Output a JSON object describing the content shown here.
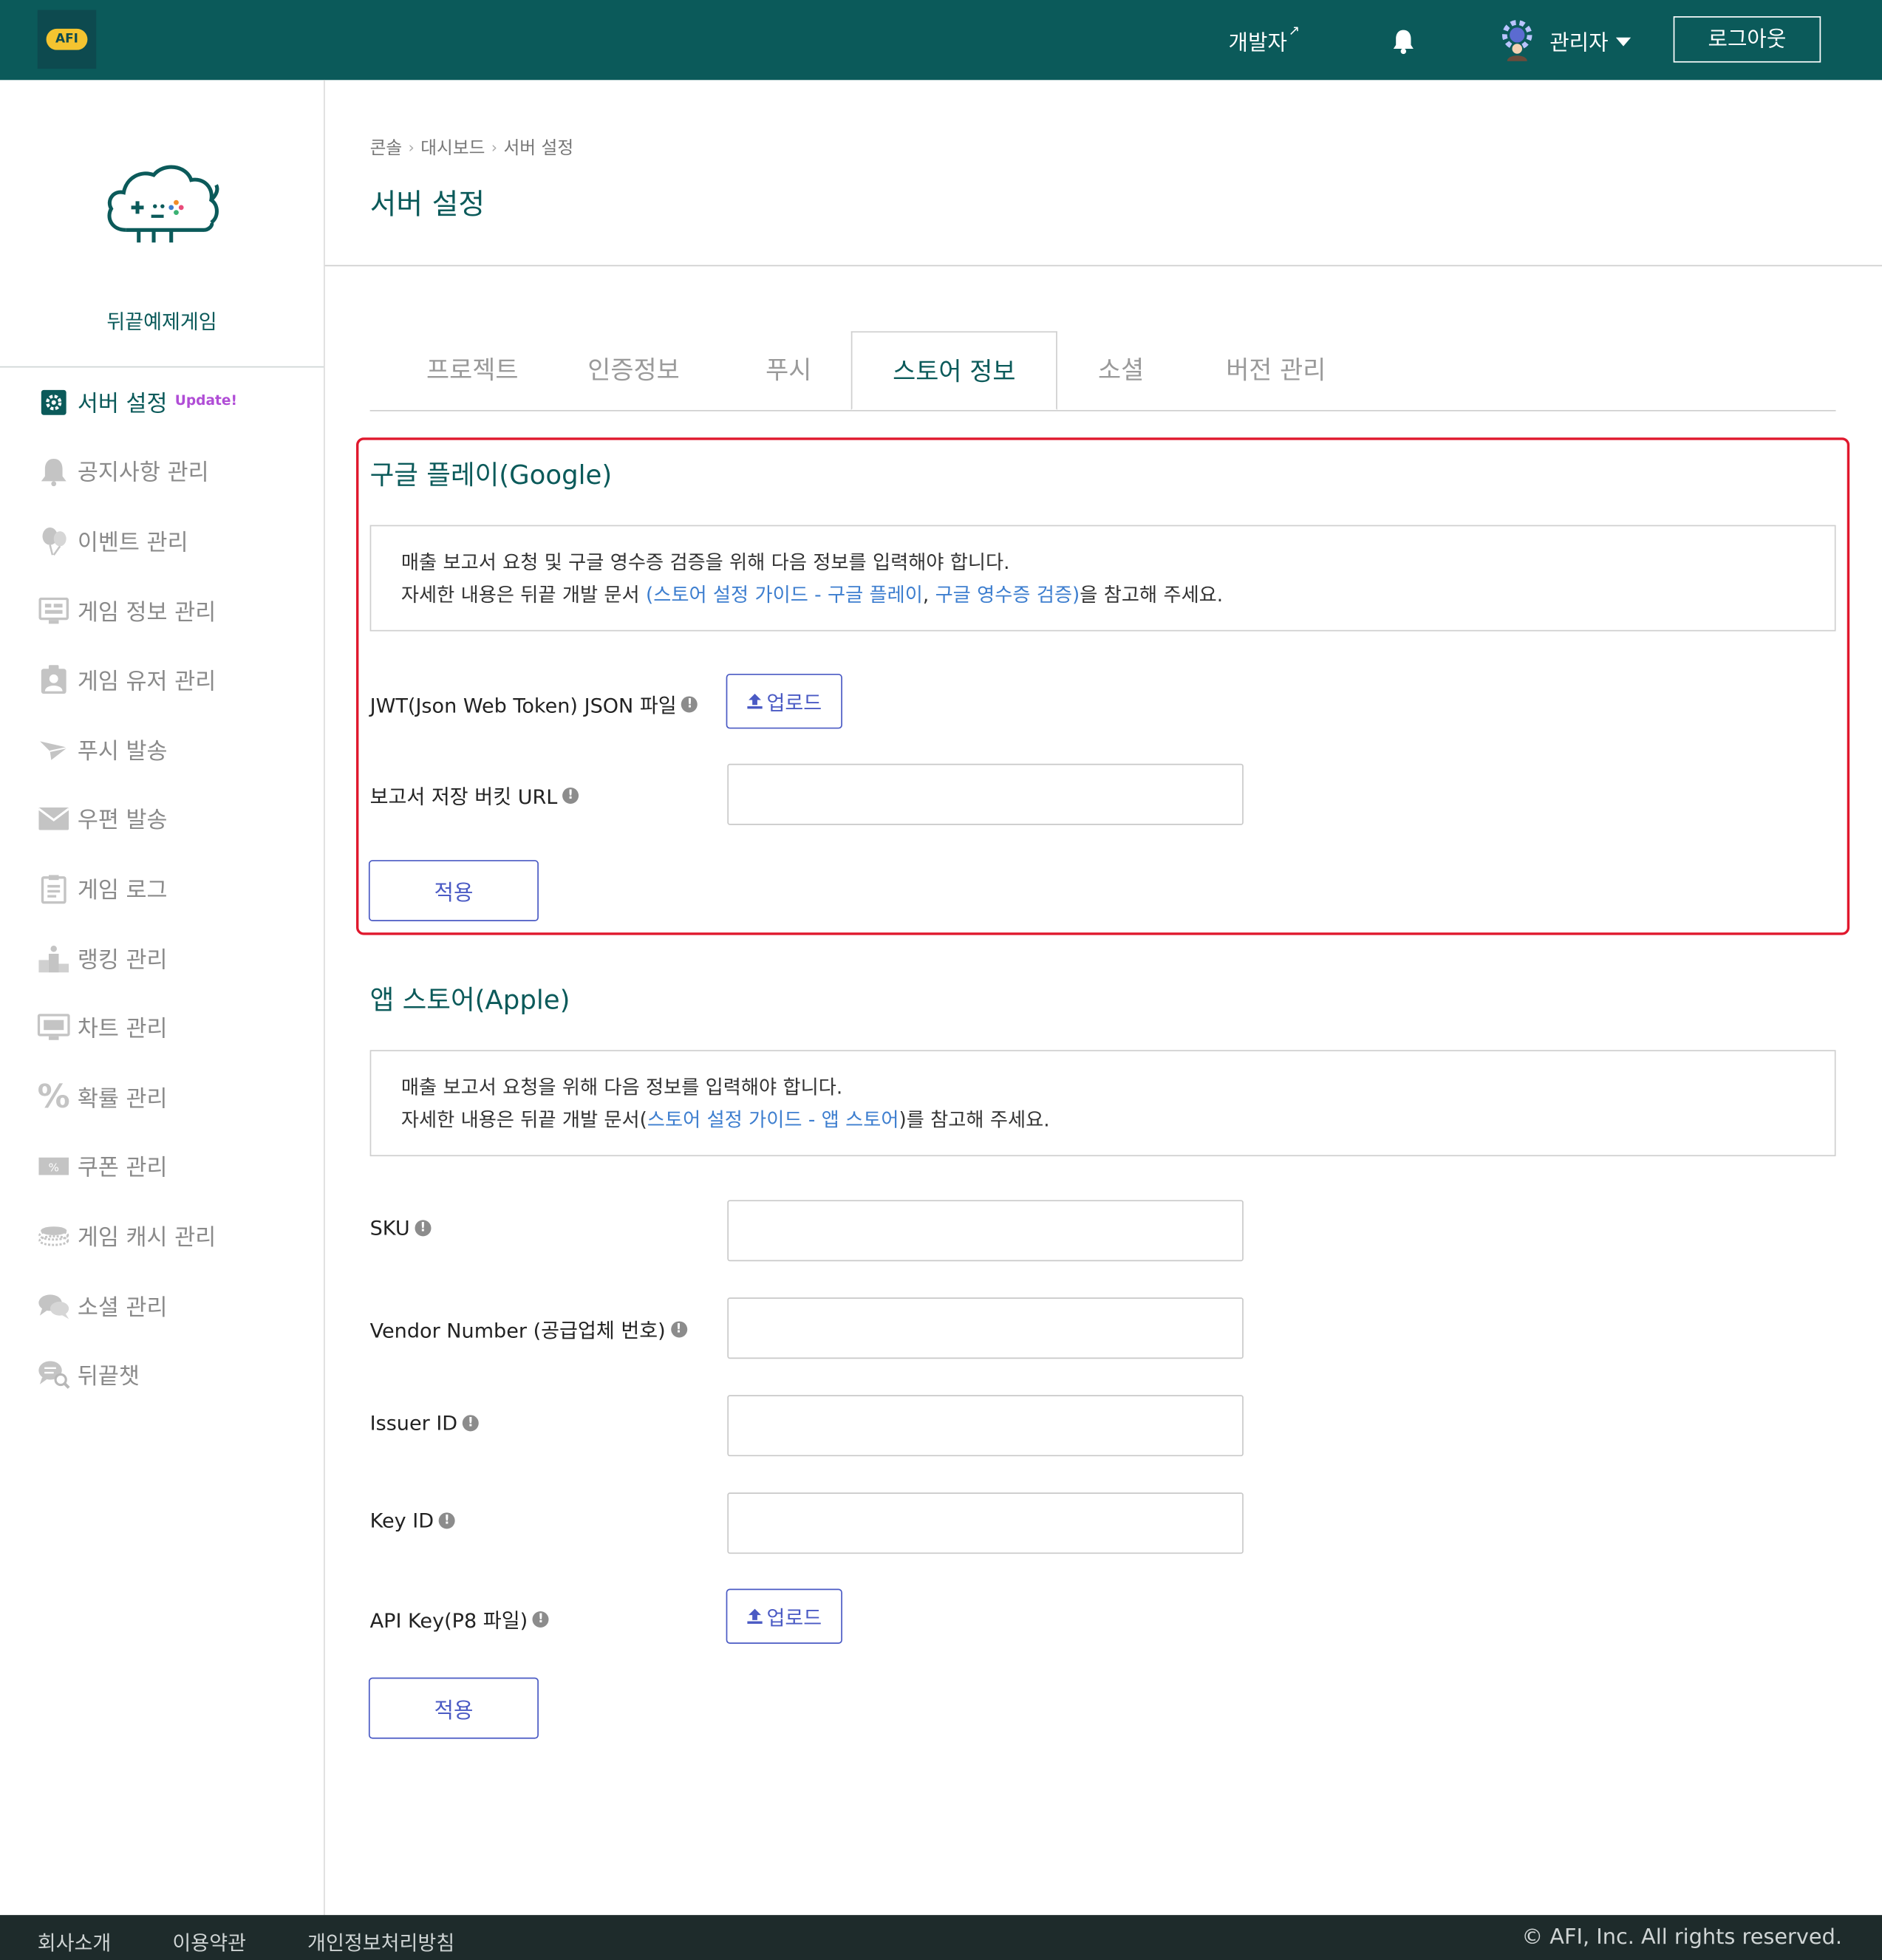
{
  "header": {
    "logo_text": "AFI",
    "dev_link": "개발자",
    "admin_label": "관리자",
    "logout_label": "로그아웃"
  },
  "sidebar": {
    "game_name": "뒤끝예제게임",
    "update_badge": "Update!",
    "items": [
      {
        "label": "서버 설정",
        "icon": "gear-icon"
      },
      {
        "label": "공지사항 관리",
        "icon": "bell-icon"
      },
      {
        "label": "이벤트 관리",
        "icon": "balloon-icon"
      },
      {
        "label": "게임 정보 관리",
        "icon": "game-info-icon"
      },
      {
        "label": "게임 유저 관리",
        "icon": "user-badge-icon"
      },
      {
        "label": "푸시 발송",
        "icon": "paper-plane-icon"
      },
      {
        "label": "우편 발송",
        "icon": "envelope-icon"
      },
      {
        "label": "게임 로그",
        "icon": "clipboard-icon"
      },
      {
        "label": "랭킹 관리",
        "icon": "podium-icon"
      },
      {
        "label": "차트 관리",
        "icon": "monitor-icon"
      },
      {
        "label": "확률 관리",
        "icon": "percent-icon"
      },
      {
        "label": "쿠폰 관리",
        "icon": "coupon-icon"
      },
      {
        "label": "게임 캐시 관리",
        "icon": "coins-icon"
      },
      {
        "label": "소셜 관리",
        "icon": "chat-bubbles-icon"
      },
      {
        "label": "뒤끝챗",
        "icon": "chat-search-icon"
      }
    ]
  },
  "breadcrumb": [
    "콘솔",
    "대시보드",
    "서버 설정"
  ],
  "page_title": "서버 설정",
  "tabs": [
    "프로젝트",
    "인증정보",
    "푸시",
    "스토어 정보",
    "소셜",
    "버전 관리"
  ],
  "active_tab": "스토어 정보",
  "google": {
    "title": "구글 플레이(Google)",
    "info_line1": "매출 보고서 요청 및 구글 영수증 검증을 위해 다음 정보를 입력해야 합니다.",
    "info_line2_prefix": "자세한 내용은 뒤끝 개발 문서 ",
    "info_link1": "(스토어 설정 가이드 - 구글 플레이",
    "info_comma": ", ",
    "info_link2": "구글 영수증 검증)",
    "info_line2_suffix": "을 참고해 주세요.",
    "jwt_label": "JWT(Json Web Token) JSON 파일",
    "upload_label": "업로드",
    "bucket_label": "보고서 저장 버킷 URL",
    "bucket_value": "",
    "apply_label": "적용"
  },
  "apple": {
    "title": "앱 스토어(Apple)",
    "info_line1": "매출 보고서 요청을 위해 다음 정보를 입력해야 합니다.",
    "info_line2_prefix": "자세한 내용은 뒤끝 개발 문서(",
    "info_link": "스토어 설정 가이드 - 앱 스토어",
    "info_line2_suffix": ")를 참고해 주세요.",
    "sku_label": "SKU",
    "sku_value": "",
    "vendor_label": "Vendor Number (공급업체 번호)",
    "vendor_value": "",
    "issuer_label": "Issuer ID",
    "issuer_value": "",
    "keyid_label": "Key ID",
    "keyid_value": "",
    "apikey_label": "API Key(P8 파일)",
    "upload_label": "업로드",
    "apply_label": "적용"
  },
  "footer": {
    "links": [
      "회사소개",
      "이용약관",
      "개인정보처리방침"
    ],
    "copyright": "© AFI, Inc. All rights reserved."
  },
  "colors": {
    "header_bg": "#0b5a5a",
    "accent": "#0b5a5a",
    "button_accent": "#4a5ac4",
    "highlight": "#e0182d",
    "link": "#3d7ecf",
    "footer_bg": "#1e2b2b"
  }
}
